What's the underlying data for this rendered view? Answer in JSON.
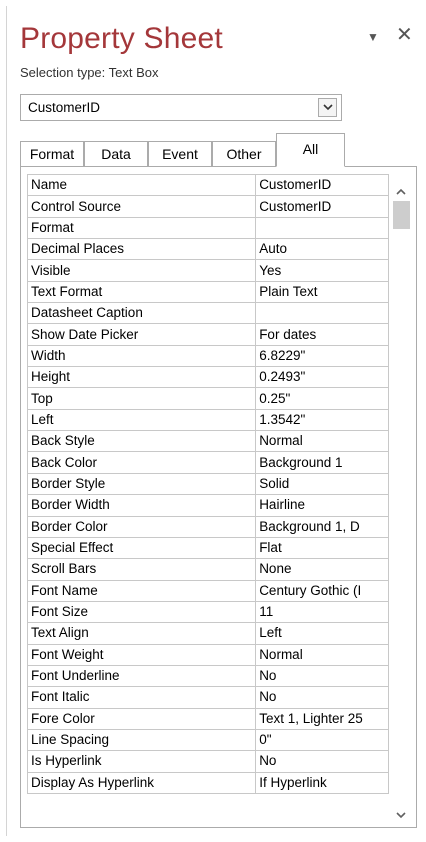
{
  "pane": {
    "title": "Property Sheet",
    "selection_type": "Selection type:  Text Box",
    "menu_icon": "dropdown-arrow-icon",
    "close_icon": "close-icon"
  },
  "combo": {
    "value": "CustomerID"
  },
  "tabs": [
    {
      "label": "Format"
    },
    {
      "label": "Data"
    },
    {
      "label": "Event"
    },
    {
      "label": "Other"
    },
    {
      "label": "All",
      "active": true
    }
  ],
  "properties": [
    {
      "name": "Name",
      "value": "CustomerID"
    },
    {
      "name": "Control Source",
      "value": "CustomerID"
    },
    {
      "name": "Format",
      "value": ""
    },
    {
      "name": "Decimal Places",
      "value": "Auto"
    },
    {
      "name": "Visible",
      "value": "Yes"
    },
    {
      "name": "Text Format",
      "value": "Plain Text"
    },
    {
      "name": "Datasheet Caption",
      "value": ""
    },
    {
      "name": "Show Date Picker",
      "value": "For dates"
    },
    {
      "name": "Width",
      "value": "6.8229\""
    },
    {
      "name": "Height",
      "value": "0.2493\""
    },
    {
      "name": "Top",
      "value": "0.25\""
    },
    {
      "name": "Left",
      "value": "1.3542\""
    },
    {
      "name": "Back Style",
      "value": "Normal"
    },
    {
      "name": "Back Color",
      "value": "Background 1"
    },
    {
      "name": "Border Style",
      "value": "Solid"
    },
    {
      "name": "Border Width",
      "value": "Hairline"
    },
    {
      "name": "Border Color",
      "value": "Background 1, D"
    },
    {
      "name": "Special Effect",
      "value": "Flat"
    },
    {
      "name": "Scroll Bars",
      "value": "None"
    },
    {
      "name": "Font Name",
      "value": "Century Gothic (I"
    },
    {
      "name": "Font Size",
      "value": "11"
    },
    {
      "name": "Text Align",
      "value": "Left"
    },
    {
      "name": "Font Weight",
      "value": "Normal"
    },
    {
      "name": "Font Underline",
      "value": "No"
    },
    {
      "name": "Font Italic",
      "value": "No"
    },
    {
      "name": "Fore Color",
      "value": "Text 1, Lighter 25"
    },
    {
      "name": "Line Spacing",
      "value": "0\""
    },
    {
      "name": "Is Hyperlink",
      "value": "No"
    },
    {
      "name": "Display As Hyperlink",
      "value": "If Hyperlink"
    }
  ],
  "colors": {
    "title": "#a4373a",
    "border": "#ababab",
    "grid_line": "#c8c8c8",
    "scroll_thumb": "#cdcdcd"
  }
}
